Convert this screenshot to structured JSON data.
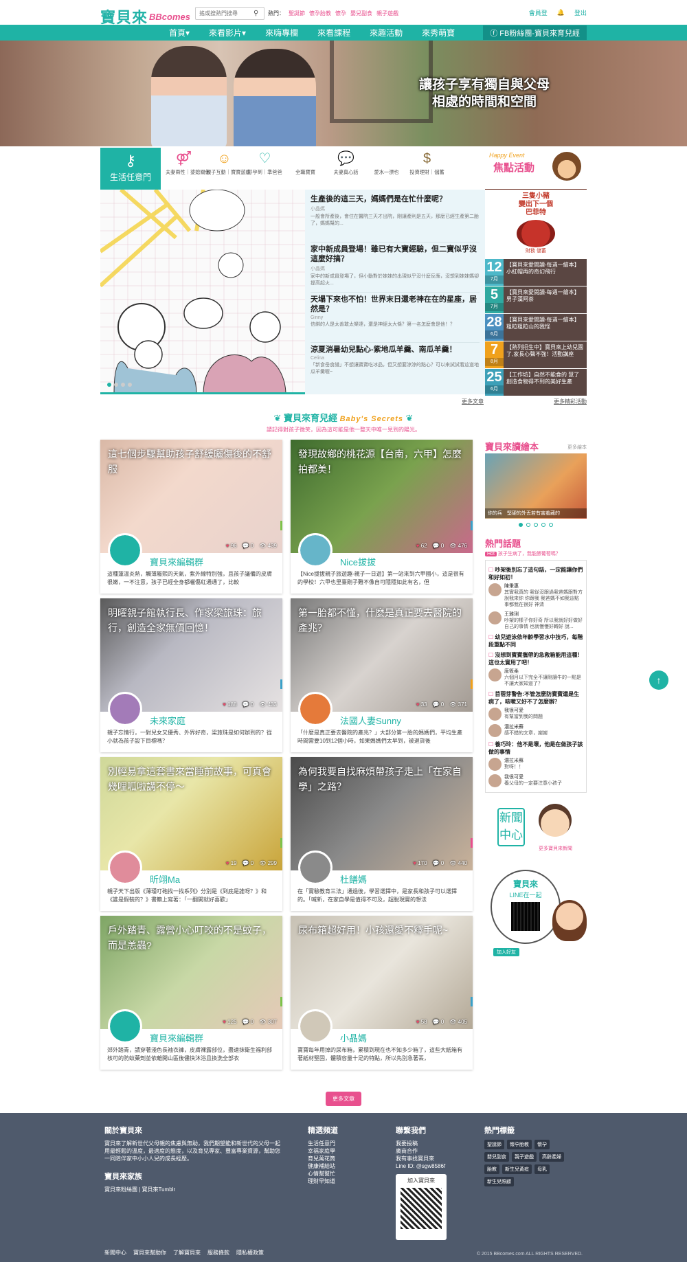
{
  "header": {
    "logo_text": "寶貝來",
    "logo_sub": "BBcomes",
    "search_placeholder": "搖或搜熱門搜尋",
    "hot_label": "熱門：",
    "hot_keywords": [
      "聖誕節",
      "懷孕胎教",
      "懷孕",
      "嬰兒副食",
      "親子遊戲"
    ],
    "login": "會員登",
    "bell_icon": "bell-icon",
    "logout": "登出"
  },
  "nav": {
    "items": [
      "首頁▾",
      "來看影片▾",
      "來嗨專欄",
      "來看課程",
      "來趣活動",
      "來秀萌寶"
    ],
    "fb": "FB粉絲團-寶貝來育兒經"
  },
  "hero": {
    "slogan1": "讓孩子享有獨自與父母",
    "slogan2": "相處的時間和空間"
  },
  "categories": {
    "head": "生活任意門",
    "items": [
      "夫妻兩性｜婆媳關係",
      "親子互動｜寶寶遊戲",
      "好孕到｜準爸爸",
      "全職寶寶",
      "夫妻真心話",
      "愛水一漂也",
      "投資理財｜儲蓄"
    ]
  },
  "event": {
    "small": "Happy Event",
    "title": "焦點活動"
  },
  "articles": [
    {
      "title": "生產後的這三天，媽媽們是在忙什麼呢？",
      "author": "小晶媽",
      "excerpt": "一般會所產後，會住在醫院三天才出院，剛讓產則是五天，那麼已經生產第二胎了，媽媽幫的..."
    },
    {
      "title": "家中新成員登場！雖已有大寶經驗，但二寶似乎沒這麼好搞？",
      "author": "小晶媽",
      "excerpt": "家中的新成員登場了，但小動對於妹妹的出現似乎沒什麼反應，沒想到妹妹媽卻提高起火..."
    },
    {
      "title": "天塌下來也不怕！世界末日還老神在在的星座，居然是？",
      "author": "Ginny",
      "excerpt": "信綁的人是太善敢太樂達，還是神經太大條？第一名怎麼會是他！？"
    },
    {
      "title": "涼夏消暑幼兒點心-紫地瓜羊羹、南瓜羊羹！",
      "author": "Celina",
      "excerpt": "「新食岳食譜」不想讓寶寶吃冰品，但又想要涼涼的點心？可以來試試看這道地瓜羊羹喔~"
    }
  ],
  "event_poster": {
    "line1": "三隻小豬",
    "line2": "變出下一個",
    "line3": "巴菲特",
    "sub": "財務 儲蓄"
  },
  "events": [
    {
      "day": "12",
      "month": "7月",
      "text": "【寶貝來愛閱讀-每週一繪本】小紅帽再的奇幻飛行",
      "color": "#4db8c9"
    },
    {
      "day": "5",
      "month": "7月",
      "text": "【寶貝來愛閱讀-每週一繪本】男子漢阿茶",
      "color": "#2fa9a0"
    },
    {
      "day": "28",
      "month": "6月",
      "text": "【寶貝來愛閱讀-每週一繪本】粗粒粗粒山的我怪",
      "color": "#4b90c0"
    },
    {
      "day": "7",
      "month": "8月",
      "text": "【熱列招生中】寶貝來上幼兒園了,家長心聲不強！活動講座",
      "color": "#f0a11c"
    },
    {
      "day": "25",
      "month": "6月",
      "text": "【工作坊】自然不能食的 慧了 創造食物得不到的美好生產",
      "color": "#3da0b8"
    }
  ],
  "more_articles": "更多文章",
  "more_events": "更多精彩活動",
  "section": {
    "title": "寶貝來育兒經",
    "title_en": "Baby's Secrets",
    "subtitle": "請記得對孩子微笑，因為這可能是他一整天中唯一見到的陽光。"
  },
  "cards": [
    {
      "title": "這七個步驟幫助孩子舒緩曬傷後的不舒服",
      "likes": "96",
      "comments": "0",
      "views": "439",
      "author": "寶貝來編輯群",
      "excerpt": "這種蓮温炎熱，觸薄屬熙的天氣，紫外線特別強，且孩子議備的皮膚很嫩，一不注意，孩子已經全身都曬傷紅通通了，比較"
    },
    {
      "title": "發現故鄉的桃花源【台南，六甲】怎麼拍都美！",
      "likes": "62",
      "comments": "0",
      "views": "476",
      "author": "Nice拔拔",
      "excerpt": "【Nice拔拔親子旅遊趣-親子一日遊】第一站來到六甲國小，這是很有的學校！六甲也里臺剛子難不像自可隱隱如此有名，但"
    },
    {
      "title": "明曜親子館執行長、作家梁旅珠：旅行，創造全家無價回憶！",
      "likes": "188",
      "comments": "0",
      "views": "433",
      "author": "未來家庭",
      "excerpt": "親子忘情行，一對兒女又優秀、外界好奇，梁旅珠是如何辦到的？從小就為孩子設下目標嗎？"
    },
    {
      "title": "第一胎都不懂，什麼是真正要去醫院的產兆？",
      "likes": "33",
      "comments": "0",
      "views": "371",
      "author": "法國人妻Sunny",
      "excerpt": "「什麼是真正要去醫院的產兆？」大部分第一胎的媽媽們，平均生產時間需要10到12個小時，如果媽媽們太早到，被退貨後"
    },
    {
      "title": "別輕易拿這套書來當睡前故事，可真會幾哩呱啦講不停～",
      "likes": "19",
      "comments": "0",
      "views": "299",
      "author": "昕翊Ma",
      "excerpt": "親子天下出版《薄瑾叮砲找一找系列》分別是《到底是誰呀？》和《誰是假裝的？》書籍上寫著：「一翻開就好喜歡」"
    },
    {
      "title": "為何我要自找麻煩帶孩子走上「在家自學」之路？",
      "likes": "170",
      "comments": "0",
      "views": "440",
      "author": "杜饍媽",
      "excerpt": "在「實驗教育三法」通過後，學習選擇中，是家長和孩子可以選擇的。「喊新，在家自學是值得不可及，超脫現實的想法"
    },
    {
      "title": "戶外踏青、露營小心叮咬的不是蚊子，而是恙蟲?",
      "likes": "125",
      "comments": "0",
      "views": "307",
      "author": "寶貝來編輯群",
      "excerpt": "郊外踏青，請穿著淺色長袖衣褲，皮膚裸露部位，盡速抹衛生福利部核可的防蚊藥劑並依離開山區後儘快沐浴且換洗全部衣"
    },
    {
      "title": "尿布箱超好用！小孩還愛不釋手呢~",
      "likes": "58",
      "comments": "0",
      "views": "405",
      "author": "小晶媽",
      "excerpt": "寶寶每年用掉的尿布箱，累積到現在也不知多少箱了，這些大紙箱有著紙材堅固，體積容量十足的特點，所以先別急著丟，"
    }
  ],
  "side": {
    "book_title": "寶貝來讀繪本",
    "book_more": "更多繪本",
    "book_caption": "你的兵　堅硬的外丟若有害羞藏的",
    "topics_title": "熱門話題",
    "hot_tag": "Hot",
    "hot_q": "孩子生病了，我能餵葡萄嗎？",
    "topics": [
      {
        "q": "吵架後別忘了這句話，一定能讓你們和好如初！",
        "replies": [
          {
            "name": "陳秉惠",
            "text": "其實我真的 我從沒跟過我爸媽跟對方說我來你 你跟我 我爸媽不如我這點事都我在很好 神清"
          },
          {
            "name": "王雅琍",
            "text": "吵架的樣子你好奇 所以我就好好做好自己的事情 也就慢慢好轉好 說..."
          }
        ]
      },
      {
        "q": "幼兒遊泳依年齡學習水中技巧，每階段重點不同"
      },
      {
        "q": "沒想到寶寶攜帶的急救箱能用這種！這也太實用了吧！",
        "replies": [
          {
            "name": "唐筱柔",
            "text": "六個月以下完全不讓剛讓牛的一點是不讓大家知道了？"
          }
        ]
      },
      {
        "q": "苜蓿芽警告:不管怎麼防寶寶還是生病了，咳嗽又好不了怎麼辦？",
        "replies": [
          {
            "name": "我很可愛",
            "text": "有幫當到我的問題"
          },
          {
            "name": "濃拉米蘇",
            "text": "感不錯的文章，謝謝"
          }
        ]
      },
      {
        "q": "養巧玲：他不是壞，他是在做孩子該做的事情",
        "replies": [
          {
            "name": "濃拉米蘇",
            "text": "對呀！！"
          },
          {
            "name": "我很可愛",
            "text": "養父母的一定要注意小孩子"
          }
        ]
      }
    ],
    "news_text": "新聞中心",
    "news_sub": "更多寶貝來新聞",
    "line_title": "寶貝來",
    "line_sub": "LINE在一起",
    "line_add": "加入好友"
  },
  "more_button": "更多文章",
  "footer": {
    "about_title": "關於寶貝來",
    "about_text": "寶貝來了解新世代父母親的焦慮與無助，我們期望能和新世代的父母一起用最輕鬆的溫度，最適度的態度，以及育兒專家、豐富專業資源，幫助您一同陪伴家中小小人兒的成長經歷。",
    "family_title": "寶貝來家族",
    "family_links": "寶貝來粉絲團 | 寶貝來Tumblr",
    "channels_title": "精選頻道",
    "channels": [
      "生活任意門",
      "幸福家庭學",
      "育兒萬花筒",
      "健康補給站",
      "心情幫幫忙",
      "理財早知道"
    ],
    "contact_title": "聯繫我們",
    "contact": [
      "我要投稿",
      "廣商合作",
      "我有事找寶貝來",
      "Line ID: @sgw8586f"
    ],
    "join": "加入寶貝來",
    "tags_title": "熱門標籤",
    "tags": [
      "聖誕節",
      "懷孕胎教",
      "懷孕",
      "嬰兒副食",
      "親子遊戲",
      "高齡產婦",
      "胎教",
      "新生兒黃疸",
      "母乳",
      "新生兒照顧"
    ],
    "links": [
      "新聞中心",
      "寶貝來幫助你",
      "了解寶貝來",
      "服務條款",
      "隱私權政策"
    ],
    "copyright": "© 2015 BBcomes.com ALL RIGHTS RESERVED."
  }
}
